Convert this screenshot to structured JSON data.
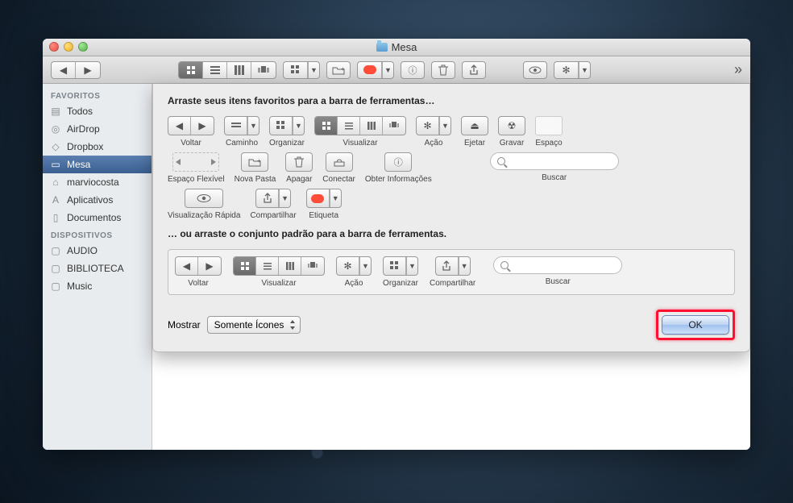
{
  "window": {
    "title": "Mesa"
  },
  "sidebar": {
    "headings": {
      "favorites": "FAVORITOS",
      "devices": "DISPOSITIVOS"
    },
    "favorites": [
      {
        "label": "Todos"
      },
      {
        "label": "AirDrop"
      },
      {
        "label": "Dropbox"
      },
      {
        "label": "Mesa"
      },
      {
        "label": "marviocosta"
      },
      {
        "label": "Aplicativos"
      },
      {
        "label": "Documentos"
      }
    ],
    "devices": [
      {
        "label": "AUDIO"
      },
      {
        "label": "BIBLIOTECA"
      },
      {
        "label": "Music"
      }
    ]
  },
  "sheet": {
    "drag_heading": "Arraste seus itens favoritos para a barra de ferramentas…",
    "default_heading": "… ou arraste o conjunto padrão para a barra de ferramentas.",
    "items": {
      "voltar": "Voltar",
      "caminho": "Caminho",
      "organizar": "Organizar",
      "visualizar": "Visualizar",
      "acao": "Ação",
      "ejetar": "Ejetar",
      "gravar": "Gravar",
      "espaco": "Espaço",
      "espaco_flex": "Espaço Flexível",
      "nova_pasta": "Nova Pasta",
      "apagar": "Apagar",
      "conectar": "Conectar",
      "obter_info": "Obter Informações",
      "buscar": "Buscar",
      "vis_rapida": "Visualização Rápida",
      "compartilhar": "Compartilhar",
      "etiqueta": "Etiqueta"
    },
    "show_label": "Mostrar",
    "show_value": "Somente Ícones",
    "ok_label": "OK"
  }
}
